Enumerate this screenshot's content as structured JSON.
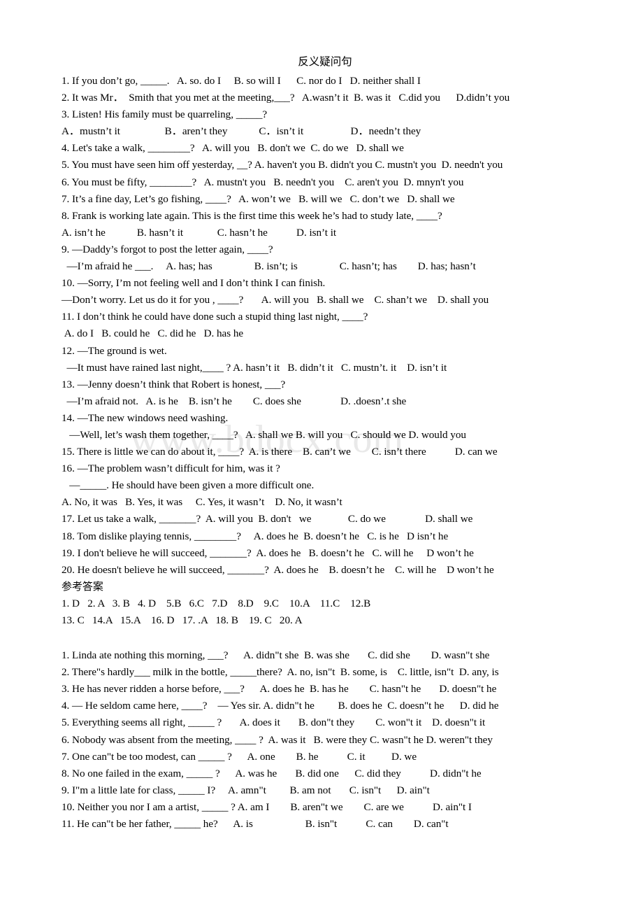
{
  "document": {
    "title": "反义疑问句",
    "watermark": "www.bdocx.com",
    "section1": {
      "lines": [
        "1. If you don’t go, _____.   A. so. do I     B. so will I      C. nor do I   D. neither shall I",
        "2. It was Mr．  Smith that you met at the meeting,___?   A.wasn’t it  B. was it   C.did you      D.didn’t you",
        "3. Listen! His family must be quarreling, _____?",
        "A．mustn’t it                 B．aren’t they            C．isn’t it                  D．needn’t they",
        "4. Let's take a walk, ________?   A. will you   B. don't we  C. do we   D. shall we",
        "5. You must have seen him off yesterday, __? A. haven't you B. didn't you C. mustn't you  D. needn't you",
        "6. You must be fifty, ________?   A. mustn't you   B. needn't you    C. aren't you  D. mnyn't you",
        "7. It’s a fine day, Let’s go fishing, ____?   A. won’t we   B. will we   C. don’t we   D. shall we",
        "8. Frank is working late again. This is the first time this week he’s had to study late, ____?",
        "A. isn’t he            B. hasn’t it             C. hasn’t he           D. isn’t it",
        "9. —Daddy’s forgot to post the letter again, ____?",
        "  —I’m afraid he ___.     A. has; has                B. isn’t; is                C. hasn’t; has        D. has; hasn’t",
        "10. —Sorry, I’m not feeling well and I don’t think I can finish.",
        "—Don’t worry. Let us do it for you , ____?       A. will you   B. shall we    C. shan’t we    D. shall you",
        "11. I don’t think he could have done such a stupid thing last night, ____?",
        " A. do I   B. could he   C. did he   D. has he",
        "12. —The ground is wet.",
        "  —It must have rained last night,____ ? A. hasn’t it   B. didn’t it   C. mustn’t. it    D. isn’t it",
        "13. —Jenny doesn’t think that Robert is honest, ___?",
        "  —I’m afraid not.   A. is he    B. isn’t he        C. does she               D. .doesn’.t she",
        "14. —The new windows need washing.",
        "   —Well, let’s wash them together, ____?   A. shall we B. will you   C. should we D. would you",
        "15. There is little we can do about it, ____?  A. is there    B. can’t we        C. isn’t there           D. can we",
        "16. —The problem wasn’t difficult for him, was it ?",
        "   —_____. He should have been given a more difficult one.",
        "A. No, it was   B. Yes, it was     C. Yes, it wasn’t    D. No, it wasn’t",
        "17. Let us take a walk, _______?  A. will you  B. don't   we              C. do we               D. shall we",
        "18. Tom dislike playing tennis, ________?     A. does he  B. doesn’t he   C. is he   D isn’t he",
        "19. I don't believe he will succeed, _______?  A. does he   B. doesn’t he   C. will he     D won’t he",
        "20. He doesn't believe he will succeed, _______?  A. does he    B. doesn’t he    C. will he    D won’t he"
      ],
      "answer_key_heading": "参考答案",
      "answer_key_lines": [
        "1. D   2. A   3. B   4. D    5.B   6.C   7.D    8.D    9.C    10.A    11.C    12.B",
        "13. C   14.A   15.A    16. D   17. .A   18. B    19. C   20. A"
      ]
    },
    "section2": {
      "lines": [
        "1. Linda ate nothing this morning, ___?      A. didn\"t she  B. was she       C. did she        D. wasn\"t she",
        "2. There\"s hardly___ milk in the bottle, _____there?  A. no, isn\"t  B. some, is    C. little, isn\"t  D. any, is",
        "3. He has never ridden a horse before, ___?      A. does he  B. has he        C. hasn\"t he       D. doesn\"t he",
        "4. — He seldom came here, ____?    — Yes sir. A. didn\"t he         B. does he  C. doesn\"t he      D. did he",
        "5. Everything seems all right, _____ ?       A. does it       B. don\"t they        C. won\"t it    D. doesn\"t it",
        "6. Nobody was absent from the meeting, ____ ?  A. was it   B. were they C. wasn\"t he D. weren\"t they",
        "7. One can\"t be too modest, can _____ ?      A. one        B. he           C. it          D. we",
        "8. No one failed in the exam, _____ ?      A. was he       B. did one      C. did they           D. didn\"t he",
        "9. I\"m a little late for class, _____ I?     A. amn\"t         B. am not       C. isn\"t      D. ain\"t",
        "10. Neither you nor I am a artist, _____ ? A. am I        B. aren\"t we        C. are we           D. ain\"t I",
        "11. He can\"t be her father, _____ he?      A. is                    B. isn\"t           C. can        D. can\"t"
      ]
    }
  }
}
